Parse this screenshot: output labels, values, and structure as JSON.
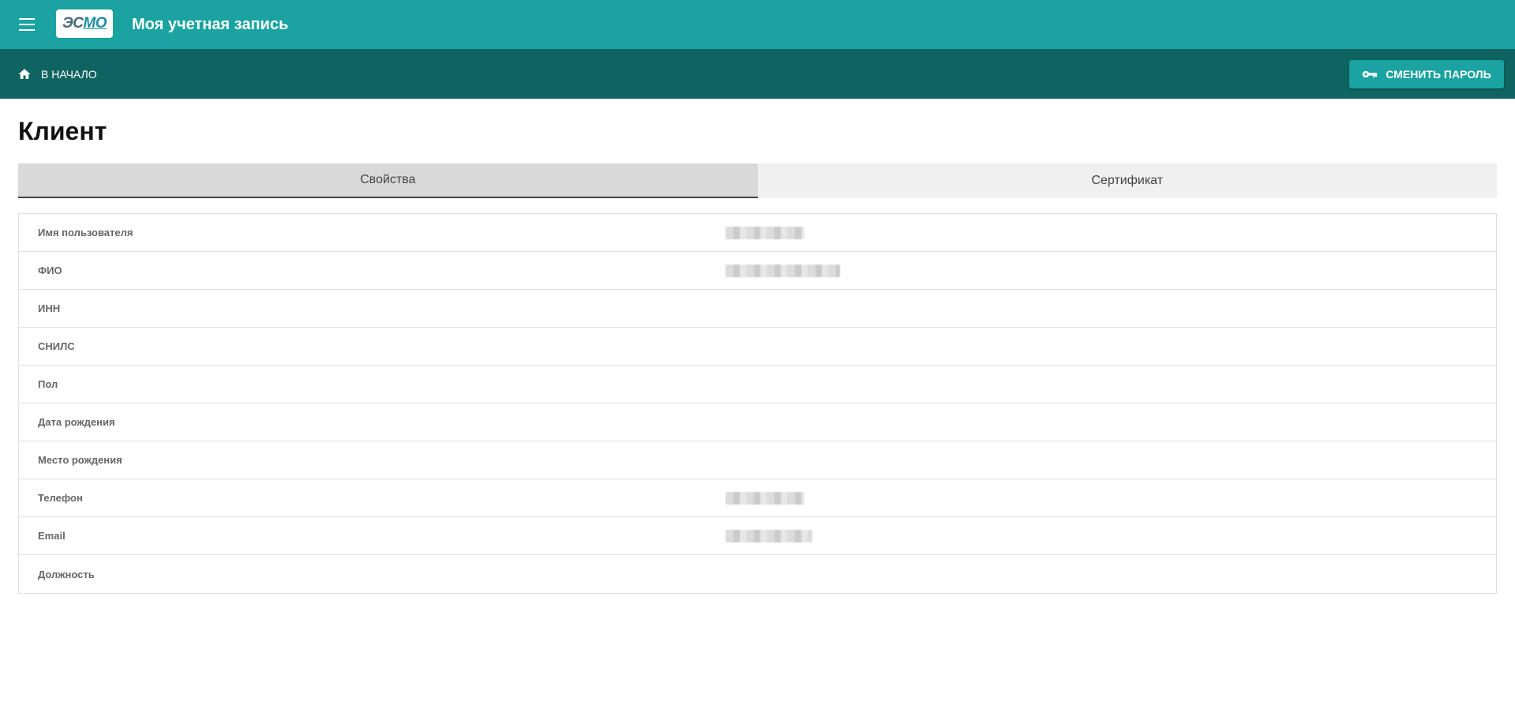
{
  "appbar": {
    "title": "Моя учетная запись",
    "logo_text_a": "ЭС",
    "logo_text_b": "МО"
  },
  "toolbar": {
    "home_label": "В НАЧАЛО",
    "change_password_label": "СМЕНИТЬ ПАРОЛЬ"
  },
  "page": {
    "title": "Клиент"
  },
  "tabs": [
    {
      "label": "Свойства",
      "active": true
    },
    {
      "label": "Сертификат",
      "active": false
    }
  ],
  "properties": [
    {
      "label": "Имя пользователя",
      "value_state": "redacted"
    },
    {
      "label": "ФИО",
      "value_state": "redacted"
    },
    {
      "label": "ИНН",
      "value_state": "empty"
    },
    {
      "label": "СНИЛС",
      "value_state": "empty"
    },
    {
      "label": "Пол",
      "value_state": "empty"
    },
    {
      "label": "Дата рождения",
      "value_state": "empty"
    },
    {
      "label": "Место рождения",
      "value_state": "empty"
    },
    {
      "label": "Телефон",
      "value_state": "redacted"
    },
    {
      "label": "Email",
      "value_state": "redacted"
    },
    {
      "label": "Должность",
      "value_state": "empty"
    }
  ],
  "colors": {
    "appbar": "#1aa3a0",
    "toolbar": "#0f6462",
    "accent_button": "#1aa3a0"
  },
  "icons": {
    "menu": "menu-icon",
    "home": "home-icon",
    "key": "key-icon"
  }
}
